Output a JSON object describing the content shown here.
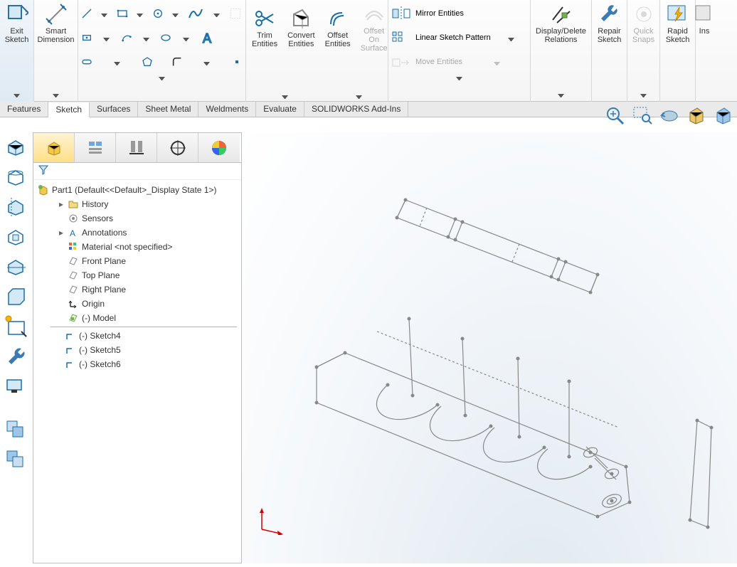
{
  "ribbon": {
    "exit_sketch": "Exit\nSketch",
    "smart_dimension": "Smart\nDimension",
    "trim_entities": "Trim\nEntities",
    "convert_entities": "Convert\nEntities",
    "offset_entities": "Offset\nEntities",
    "offset_on_surface": "Offset\nOn\nSurface",
    "mirror_entities": "Mirror Entities",
    "linear_sketch_pattern": "Linear Sketch Pattern",
    "move_entities": "Move Entities",
    "display_delete_relations": "Display/Delete\nRelations",
    "repair_sketch": "Repair\nSketch",
    "quick_snaps": "Quick\nSnaps",
    "rapid_sketch": "Rapid\nSketch",
    "instant": "Ins"
  },
  "tabs": [
    "Features",
    "Sketch",
    "Surfaces",
    "Sheet Metal",
    "Weldments",
    "Evaluate",
    "SOLIDWORKS Add-Ins"
  ],
  "tree": {
    "root": "Part1  (Default<<Default>_Display State 1>)",
    "items": [
      {
        "label": "History"
      },
      {
        "label": "Sensors"
      },
      {
        "label": "Annotations"
      },
      {
        "label": "Material <not specified>"
      },
      {
        "label": "Front Plane"
      },
      {
        "label": "Top Plane"
      },
      {
        "label": "Right Plane"
      },
      {
        "label": "Origin"
      },
      {
        "label": "(-) Model"
      },
      {
        "label": "(-) Sketch4"
      },
      {
        "label": "(-) Sketch5"
      },
      {
        "label": "(-) Sketch6"
      }
    ]
  }
}
